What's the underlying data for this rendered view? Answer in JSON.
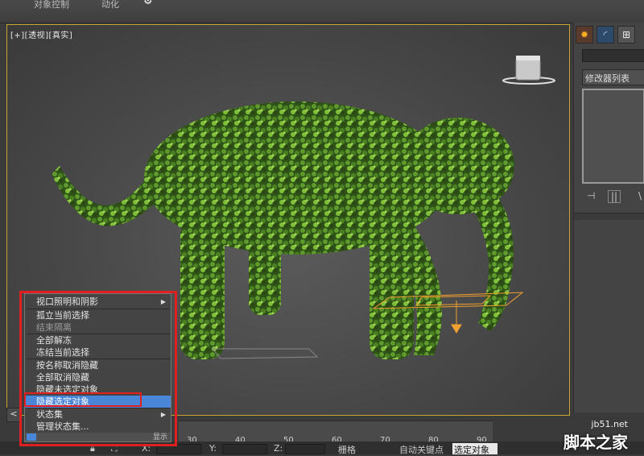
{
  "topbar": {
    "left_label": "对象控制",
    "mid_label": "动化"
  },
  "viewport": {
    "label": "[+][透视][真实]"
  },
  "right_panel": {
    "modifier_list_label": "修改器列表"
  },
  "menu": {
    "items": [
      {
        "label": "视口照明和阴影",
        "submenu": true
      },
      {
        "label": "孤立当前选择"
      },
      {
        "label": "结束隔离",
        "disabled": true
      },
      {
        "label": "全部解冻"
      },
      {
        "label": "冻结当前选择"
      },
      {
        "label": "按名称取消隐藏"
      },
      {
        "label": "全部取消隐藏"
      },
      {
        "label": "隐藏未选定对象"
      },
      {
        "label": "隐藏选定对象",
        "highlighted": true
      },
      {
        "label": "状态集",
        "submenu": true
      },
      {
        "label": "管理状态集..."
      }
    ],
    "footer_label": "显示"
  },
  "timeline": {
    "ticks": [
      "30",
      "40",
      "50",
      "60",
      "70",
      "80",
      "90"
    ]
  },
  "status": {
    "auto_key_label": "自动关键点",
    "selected_label": "选定对象",
    "x_label": "X:",
    "y_label": "Y:",
    "z_label": "Z:",
    "grid_label": "栅格"
  },
  "watermark": {
    "site": "jb51.net",
    "name": "脚本之家"
  },
  "colors": {
    "accent": "#4a86d8",
    "highlight_box": "#e02020",
    "viewport_border": "#c7a534",
    "foliage": "#3d6b1f"
  }
}
